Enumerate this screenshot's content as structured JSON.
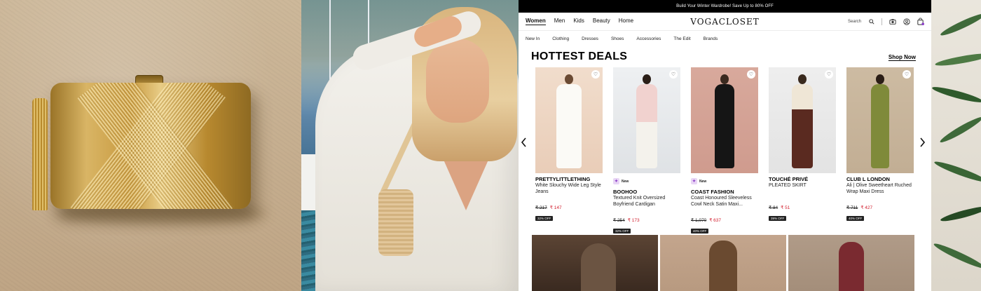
{
  "promo_bar": {
    "text": "Build Your Winter Wardrobe! Save Up to 80% OFF"
  },
  "header": {
    "logo": "VOGACLOSET",
    "categories": [
      "Women",
      "Men",
      "Kids",
      "Beauty",
      "Home"
    ],
    "active_category": "Women",
    "search_label": "Search"
  },
  "subnav": [
    "New In",
    "Clothing",
    "Dresses",
    "Shoes",
    "Accessories",
    "The Edit",
    "Brands"
  ],
  "deals": {
    "title": "HOTTEST DEALS",
    "shop_now": "Shop Now",
    "products": [
      {
        "brand": "PRETTYLITTLETHING",
        "name": "White Slouchy Wide Leg Style Jeans",
        "badge": "",
        "orig_price": "₹ 217",
        "sale_price": "₹ 147",
        "off": "32% OFF"
      },
      {
        "brand": "BOOHOO",
        "name": "Textured Knit Oversized Boyfriend Cardigan",
        "badge": "New",
        "orig_price": "₹ 254",
        "sale_price": "₹ 173",
        "off": "32% OFF"
      },
      {
        "brand": "COAST FASHION",
        "name": "Coast Honoured Sleeveless Cowl Neck Satin Maxi...",
        "badge": "New",
        "orig_price": "₹ 1,070",
        "sale_price": "₹ 637",
        "off": "40% OFF"
      },
      {
        "brand": "TOUCHÉ PRIVÉ",
        "name": "PLEATED SKIRT",
        "badge": "",
        "orig_price": "₹ 84",
        "sale_price": "₹ 51",
        "off": "39% OFF"
      },
      {
        "brand": "CLUB L LONDON",
        "name": "Ali | Olive Sweetheart Ruched Wrap Maxi Dress",
        "badge": "",
        "orig_price": "₹ 711",
        "sale_price": "₹ 427",
        "off": "40% OFF"
      }
    ]
  },
  "icons": {
    "search": "search-icon",
    "camera": "camera-search-icon",
    "account": "account-icon",
    "bag": "shopping-bag-icon",
    "heart": "heart-icon",
    "prev": "chevron-left-icon",
    "next": "chevron-right-icon"
  },
  "colors": {
    "sale": "#d2202f",
    "new_badge": "#8a3cc7",
    "promo_bg": "#000000"
  }
}
